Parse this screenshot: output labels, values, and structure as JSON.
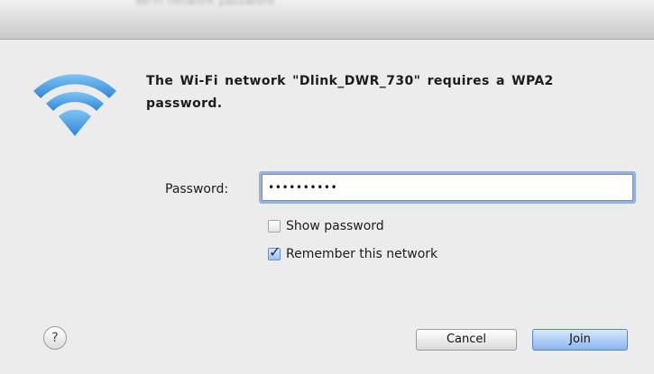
{
  "window": {
    "title_text": "Wi-Fi network password"
  },
  "dialog": {
    "message": "The Wi-Fi network \"Dlink_DWR_730\" requires a WPA2 password.",
    "password_label": "Password:",
    "password_value": "••••••••••",
    "show_password_label": "Show password",
    "show_password_checked": false,
    "remember_label": "Remember this network",
    "remember_checked": true,
    "help_symbol": "?",
    "cancel_label": "Cancel",
    "join_label": "Join"
  },
  "icons": {
    "wifi": "wifi-icon",
    "help": "question-mark-icon",
    "check": "checkmark-icon"
  },
  "colors": {
    "accent": "#4a90d9",
    "dialog_bg": "#ececec",
    "default_button": "#8ab4ee"
  }
}
